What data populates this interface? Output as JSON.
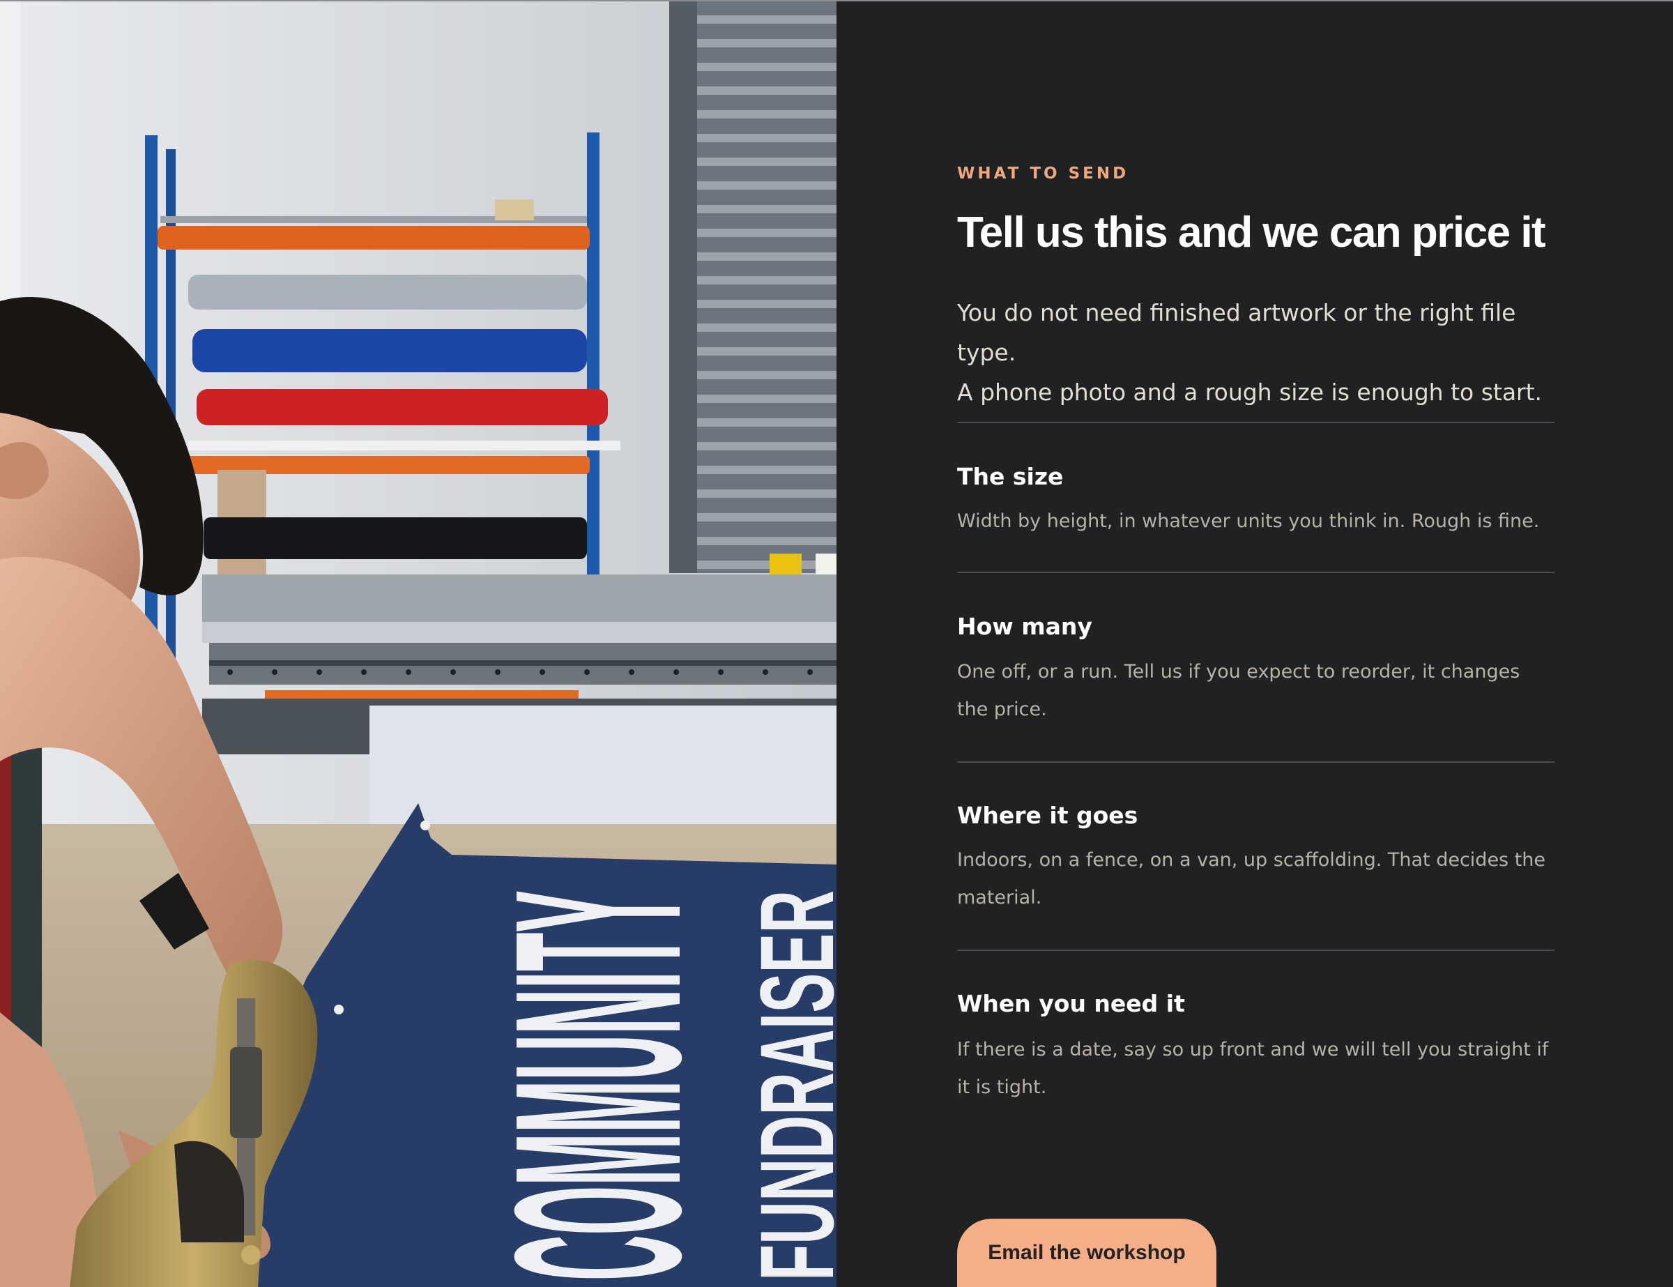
{
  "photo": {
    "banner_line_1": "COMMUNITY",
    "banner_line_2": "FUNDRAISER"
  },
  "section": {
    "eyebrow": "WHAT TO SEND",
    "title": "Tell us this and we can price it",
    "intro_line_1": "You do not need finished artwork or the right file type.",
    "intro_line_2": "A phone photo and a rough size is enough to start."
  },
  "items": [
    {
      "title": "The size",
      "body": "Width by height, in whatever units you think in. Rough is fine."
    },
    {
      "title": "How many",
      "body": "One off, or a run. Tell us if you expect to reorder, it changes the price."
    },
    {
      "title": "Where it goes",
      "body": "Indoors, on a fence, on a van, up scaffolding. That decides the material."
    },
    {
      "title": "When you need it",
      "body": "If there is a date, say so up front and we will tell you straight if it is tight."
    }
  ],
  "cta": {
    "label": "Email the workshop"
  },
  "colors": {
    "background": "#202123",
    "accent": "#f1a77c",
    "button": "#f5ae85",
    "heading": "#ffffff",
    "body": "#b9b2a6"
  }
}
